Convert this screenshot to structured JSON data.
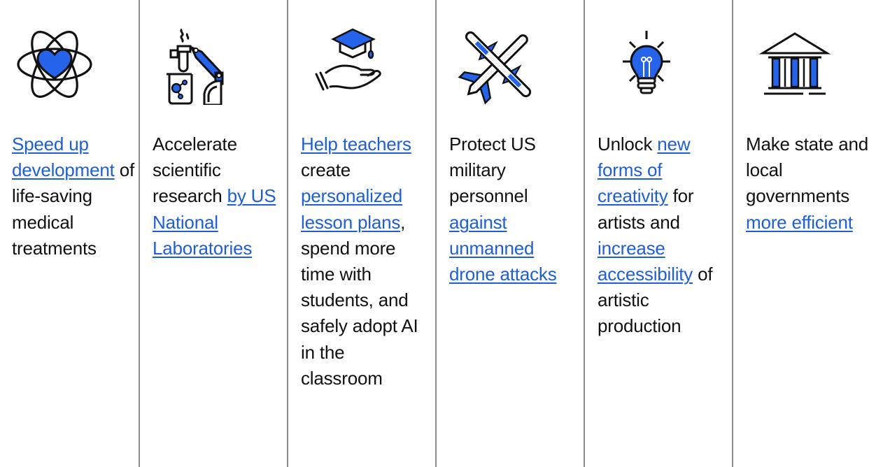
{
  "colors": {
    "accent": "#2563eb",
    "link": "#1f5fd1",
    "text": "#111111",
    "divider": "#8a8a8a"
  },
  "columns": [
    {
      "icon": "atom-heart-icon",
      "segments": [
        {
          "type": "link",
          "text": "Speed up development"
        },
        {
          "type": "text",
          "text": " of life-saving medical treatments"
        }
      ]
    },
    {
      "icon": "lab-robot-arm-icon",
      "segments": [
        {
          "type": "text",
          "text": "Accelerate scientific research "
        },
        {
          "type": "link",
          "text": "by US National Laboratories"
        }
      ]
    },
    {
      "icon": "graduation-cap-hand-icon",
      "segments": [
        {
          "type": "link",
          "text": "Help teachers"
        },
        {
          "type": "text",
          "text": " create "
        },
        {
          "type": "link",
          "text": "personalized lesson plans"
        },
        {
          "type": "text",
          "text": ", spend more time with students, and safely adopt AI in the classroom"
        }
      ]
    },
    {
      "icon": "drone-aircraft-icon",
      "segments": [
        {
          "type": "text",
          "text": "Protect US military personnel "
        },
        {
          "type": "link",
          "text": "against unmanned drone attacks"
        }
      ]
    },
    {
      "icon": "lightbulb-icon",
      "segments": [
        {
          "type": "text",
          "text": "Unlock "
        },
        {
          "type": "link",
          "text": "new forms of creativity"
        },
        {
          "type": "text",
          "text": " for artists and "
        },
        {
          "type": "link",
          "text": "increase accessibility"
        },
        {
          "type": "text",
          "text": " of artistic production"
        }
      ]
    },
    {
      "icon": "government-building-icon",
      "segments": [
        {
          "type": "text",
          "text": "Make state and local governments "
        },
        {
          "type": "link",
          "text": "more efficient"
        }
      ]
    }
  ]
}
